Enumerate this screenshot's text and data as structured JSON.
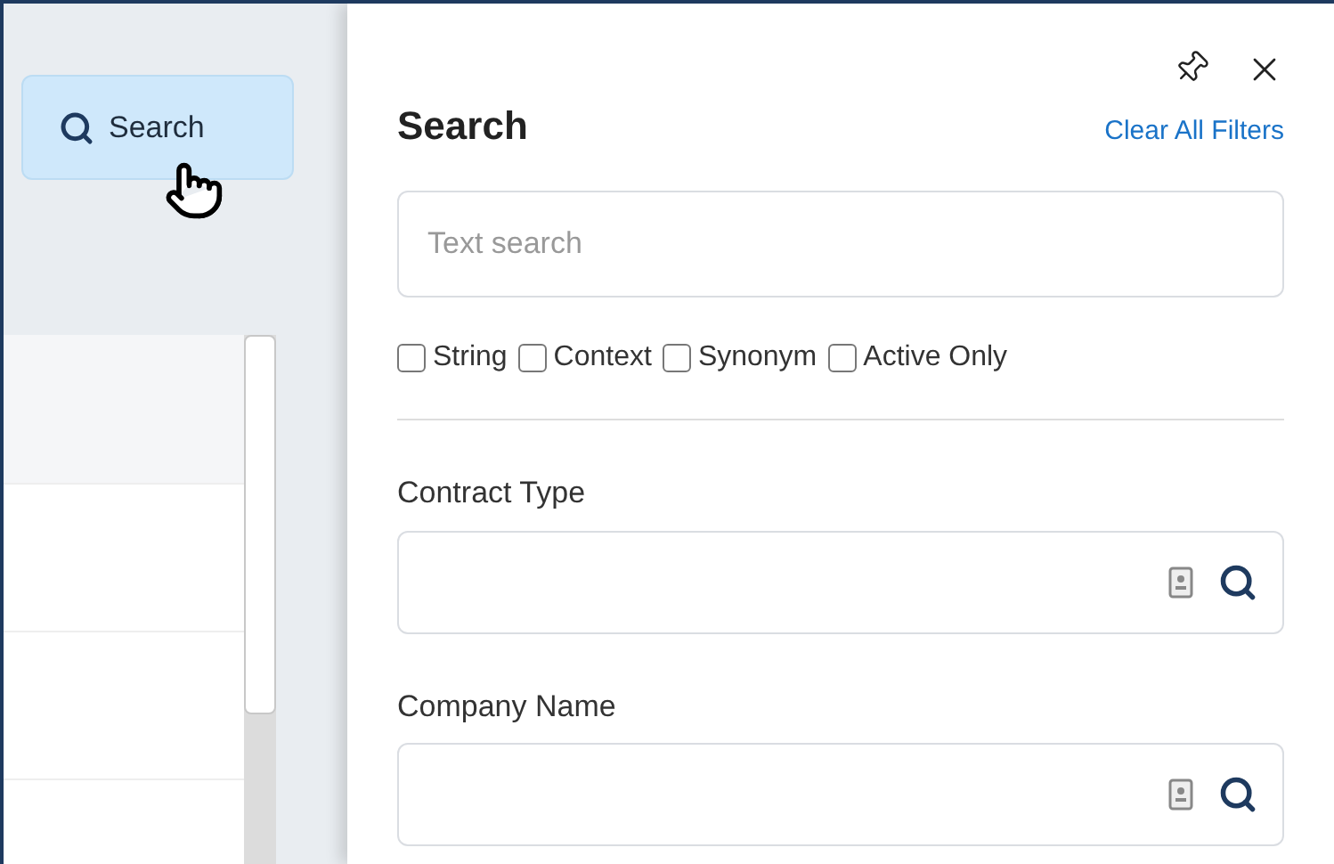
{
  "toolbar": {
    "search_button": "Search"
  },
  "panel": {
    "title": "Search",
    "clear_link": "Clear All Filters",
    "text_search": {
      "placeholder": "Text search"
    },
    "options": [
      {
        "label": "String",
        "checked": false
      },
      {
        "label": "Context",
        "checked": false
      },
      {
        "label": "Synonym",
        "checked": false
      },
      {
        "label": "Active Only",
        "checked": false
      }
    ],
    "filters": [
      {
        "label": "Contract Type"
      },
      {
        "label": "Company Name"
      }
    ]
  }
}
